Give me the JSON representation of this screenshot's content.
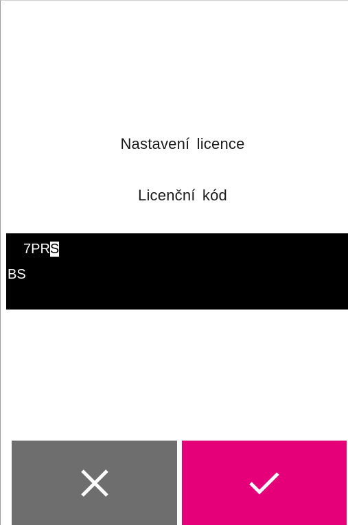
{
  "screen": {
    "title": "Nastavení licence",
    "subtitle": "Licenční kód"
  },
  "code_field": {
    "line1_prefix": "7PR",
    "line1_cursor_char": "S",
    "line2": "BS"
  },
  "buttons": {
    "cancel_icon": "close-icon",
    "confirm_icon": "check-icon",
    "cancel_color": "#6e6e6e",
    "confirm_color": "#e5007a"
  }
}
